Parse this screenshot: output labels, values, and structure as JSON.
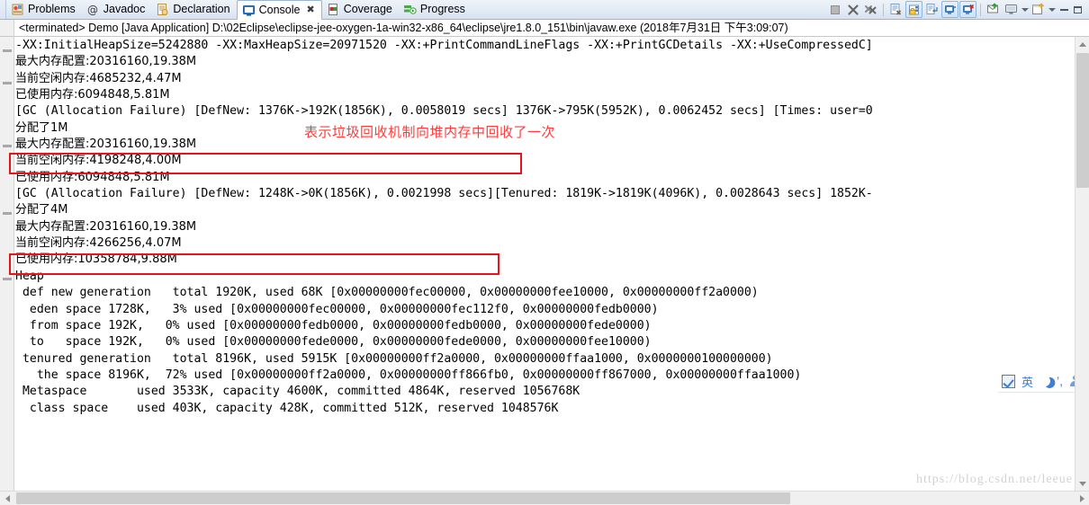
{
  "window": {
    "title": "Console"
  },
  "tabs": [
    {
      "label": "Problems",
      "icon": "problems-icon",
      "active": false,
      "closable": false
    },
    {
      "label": "Javadoc",
      "icon": "javadoc-icon",
      "active": false,
      "closable": false
    },
    {
      "label": "Declaration",
      "icon": "declaration-icon",
      "active": false,
      "closable": false
    },
    {
      "label": "Console",
      "icon": "console-icon",
      "active": true,
      "closable": true
    },
    {
      "label": "Coverage",
      "icon": "coverage-icon",
      "active": false,
      "closable": false
    },
    {
      "label": "Progress",
      "icon": "progress-icon",
      "active": false,
      "closable": false
    }
  ],
  "tab_close_glyph": "✖",
  "toolbar": [
    {
      "name": "terminate-button",
      "icon": "stop-square-icon",
      "framed": false
    },
    {
      "name": "remove-launch-button",
      "icon": "x-icon",
      "framed": false
    },
    {
      "name": "remove-all-terminated-button",
      "icon": "double-x-icon",
      "framed": false
    },
    {
      "name": "separator-1",
      "icon": "separator",
      "framed": false
    },
    {
      "name": "clear-console-button",
      "icon": "clear-console-icon",
      "framed": false
    },
    {
      "name": "scroll-lock-button",
      "icon": "lock-icon",
      "framed": true
    },
    {
      "name": "word-wrap-button",
      "icon": "word-wrap-icon",
      "framed": false
    },
    {
      "name": "pin-console-button",
      "icon": "pin-console-icon",
      "framed": true
    },
    {
      "name": "display-selected-console-button",
      "icon": "display-console-icon",
      "framed": true
    },
    {
      "name": "separator-2",
      "icon": "separator",
      "framed": false
    },
    {
      "name": "open-console-button",
      "icon": "open-console-icon",
      "framed": false
    },
    {
      "name": "new-console-view-button",
      "icon": "monitor-icon",
      "framed": false
    },
    {
      "name": "new-console-dropdown",
      "icon": "chevron-down-icon",
      "framed": false
    },
    {
      "name": "view-menu-button",
      "icon": "new-window-icon",
      "framed": false
    },
    {
      "name": "view-menu-dropdown",
      "icon": "chevron-down-icon",
      "framed": false
    }
  ],
  "window_controls": {
    "minimize": "minimize-icon",
    "maximize": "maximize-icon"
  },
  "console_header": {
    "text": "<terminated> Demo [Java Application] D:\\02Eclipse\\eclipse-jee-oxygen-1a-win32-x86_64\\eclipse\\jre1.8.0_151\\bin\\javaw.exe (2018年7月31日 下午3:09:07)"
  },
  "annotation": {
    "text": "表示垃圾回收机制向堆内存中回收了一次",
    "color": "#ff3b3b"
  },
  "highlight_color": "#e8141c",
  "console_lines": [
    {
      "text": "-XX:InitialHeapSize=5242880 -XX:MaxHeapSize=20971520 -XX:+PrintCommandLineFlags -XX:+PrintGCDetails -XX:+UseCompressedC]",
      "cjk": false
    },
    {
      "text": "最大内存配置:20316160,19.38M",
      "cjk": true
    },
    {
      "text": "当前空闲内存:4685232,4.47M",
      "cjk": true
    },
    {
      "text": "已使用内存:6094848,5.81M",
      "cjk": true
    },
    {
      "text": "[GC (Allocation Failure) [DefNew: 1376K->192K(1856K), 0.0058019 secs] 1376K->795K(5952K), 0.0062452 secs] [Times: user=0",
      "cjk": false
    },
    {
      "text": "分配了1M",
      "cjk": true
    },
    {
      "text": "最大内存配置:20316160,19.38M",
      "cjk": true
    },
    {
      "text": "当前空闲内存:4198248,4.00M",
      "cjk": true
    },
    {
      "text": "已使用内存:6094848,5.81M",
      "cjk": true
    },
    {
      "text": "[GC (Allocation Failure) [DefNew: 1248K->0K(1856K), 0.0021998 secs][Tenured: 1819K->1819K(4096K), 0.0028643 secs] 1852K-",
      "cjk": false
    },
    {
      "text": "分配了4M",
      "cjk": true
    },
    {
      "text": "最大内存配置:20316160,19.38M",
      "cjk": true
    },
    {
      "text": "当前空闲内存:4266256,4.07M",
      "cjk": true
    },
    {
      "text": "已使用内存:10358784,9.88M",
      "cjk": true
    },
    {
      "text": "Heap",
      "cjk": false
    },
    {
      "text": " def new generation   total 1920K, used 68K [0x00000000fec00000, 0x00000000fee10000, 0x00000000ff2a0000)",
      "cjk": false
    },
    {
      "text": "  eden space 1728K,   3% used [0x00000000fec00000, 0x00000000fec112f0, 0x00000000fedb0000)",
      "cjk": false
    },
    {
      "text": "  from space 192K,   0% used [0x00000000fedb0000, 0x00000000fedb0000, 0x00000000fede0000)",
      "cjk": false
    },
    {
      "text": "  to   space 192K,   0% used [0x00000000fede0000, 0x00000000fede0000, 0x00000000fee10000)",
      "cjk": false
    },
    {
      "text": " tenured generation   total 8196K, used 5915K [0x00000000ff2a0000, 0x00000000ffaa1000, 0x0000000100000000)",
      "cjk": false
    },
    {
      "text": "   the space 8196K,  72% used [0x00000000ff2a0000, 0x00000000ff866fb0, 0x00000000ff867000, 0x00000000ffaa1000)",
      "cjk": false
    },
    {
      "text": " Metaspace       used 3533K, capacity 4600K, committed 4864K, reserved 1056768K",
      "cjk": false
    },
    {
      "text": "  class space    used 403K, capacity 428K, committed 512K, reserved 1048576K",
      "cjk": false
    }
  ],
  "ime_bar": {
    "mode_label": "英",
    "items": [
      "ime-checkbox",
      "ime-mode-chinese",
      "ime-moon-icon",
      "ime-punctuation-icon",
      "ime-user-icon"
    ]
  },
  "watermark": {
    "text": "https://blog.csdn.net/leeue"
  }
}
